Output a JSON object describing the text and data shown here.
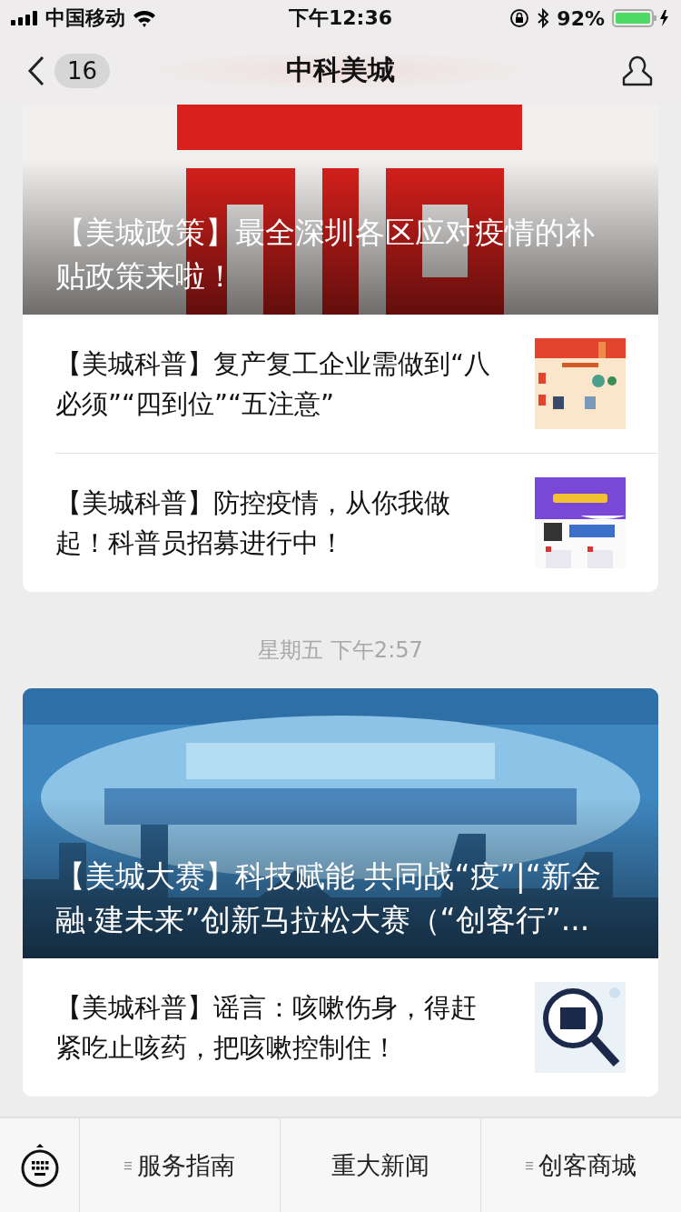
{
  "status_bar": {
    "carrier": "中国移动",
    "time": "下午12:36",
    "battery": "92%"
  },
  "nav": {
    "badge": "16",
    "title": "中科美城"
  },
  "feed": [
    {
      "kind": "card",
      "cut_top": true,
      "cover": {
        "title": "【美城政策】最全深圳各区应对疫情的补贴政策来啦！"
      },
      "articles": [
        {
          "title": "【美城科普】复产复工企业需做到“八必须”“四到位”“五注意”"
        },
        {
          "title": "【美城科普】防控疫情，从你我做起！科普员招募进行中！"
        }
      ]
    },
    {
      "kind": "time",
      "text": "星期五 下午2:57"
    },
    {
      "kind": "card",
      "cut_top": false,
      "cover": {
        "title": "【美城大赛】科技赋能 共同战“疫”|“新金融·建未来”创新马拉松大赛（“创客行”..."
      },
      "articles": [
        {
          "title": "【美城科普】谣言：咳嗽伤身，得赶紧吃止咳药，把咳嗽控制住！"
        }
      ]
    }
  ],
  "menu": [
    {
      "label": "服务指南",
      "submenu": true
    },
    {
      "label": "重大新闻",
      "submenu": false
    },
    {
      "label": "创客商城",
      "submenu": true
    }
  ]
}
